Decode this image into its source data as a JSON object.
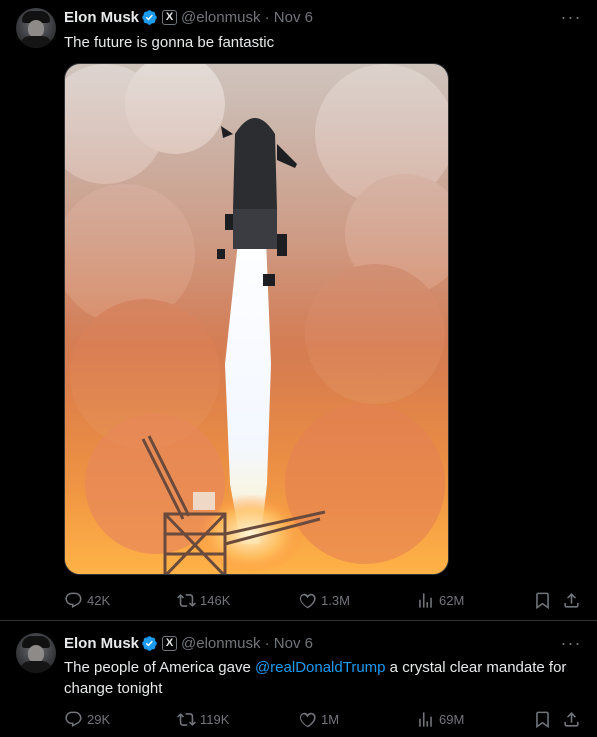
{
  "tweets": [
    {
      "author": "Elon Musk",
      "badge": "X",
      "handle_date": "@elonmusk · Nov 6",
      "text": "The future is gonna be fantastic",
      "stats": {
        "replies": "42K",
        "reposts": "146K",
        "likes": "1.3M",
        "views": "62M"
      }
    },
    {
      "author": "Elon Musk",
      "badge": "X",
      "handle_date": "@elonmusk · Nov 6",
      "text_before": "The people of America gave ",
      "mention": "@realDonaldTrump",
      "text_after": " a crystal clear mandate for change tonight",
      "stats": {
        "replies": "29K",
        "reposts": "119K",
        "likes": "1M",
        "views": "69M"
      }
    }
  ],
  "colors": {
    "background": "#000000",
    "text": "#e7e9ea",
    "muted": "#71767b",
    "accent": "#1d9bf0",
    "border": "#2f3336"
  },
  "icons": [
    "verified-badge-icon",
    "more-icon",
    "reply-icon",
    "repost-icon",
    "like-icon",
    "views-icon",
    "bookmark-icon",
    "share-icon"
  ]
}
